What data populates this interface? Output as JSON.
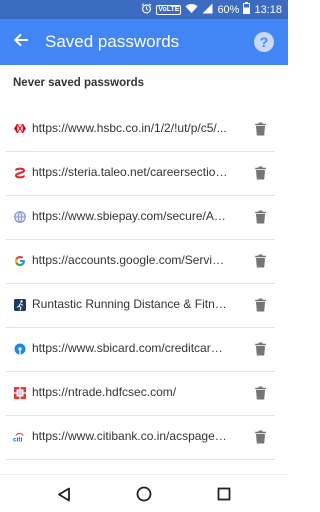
{
  "status_bar": {
    "battery": "60%",
    "time": "13:18",
    "network_badge": "VoLTE",
    "icons": [
      "alarm-icon",
      "wifi-icon",
      "signal-icon",
      "battery-icon"
    ]
  },
  "app_bar": {
    "title": "Saved passwords",
    "back_icon": "back-arrow-icon",
    "help_icon": "help-icon",
    "help_glyph": "?",
    "background": "#4285f4"
  },
  "section": {
    "title": "Never saved passwords"
  },
  "items": [
    {
      "label": "https://www.hsbc.co.in/1/2/!ut/p/c5/...",
      "favicon": "hsbc-favicon"
    },
    {
      "label": "https://steria.taleo.net/careersection...",
      "favicon": "steria-favicon"
    },
    {
      "label": "https://www.sbiepay.com/secure/Ag...",
      "favicon": "sbiepay-favicon"
    },
    {
      "label": "https://accounts.google.com/Service...",
      "favicon": "google-favicon"
    },
    {
      "label": "Runtastic Running Distance & Fitness...",
      "favicon": "runtastic-favicon"
    },
    {
      "label": "https://www.sbicard.com/creditcards...",
      "favicon": "sbicard-favicon"
    },
    {
      "label": "https://ntrade.hdfcsec.com/",
      "favicon": "hdfcsec-favicon"
    },
    {
      "label": "https://www.citibank.co.in/acspage/c...",
      "favicon": "citibank-favicon"
    }
  ],
  "nav_bar": {
    "icons": [
      "back-triangle-icon",
      "home-circle-icon",
      "recents-square-icon"
    ]
  }
}
